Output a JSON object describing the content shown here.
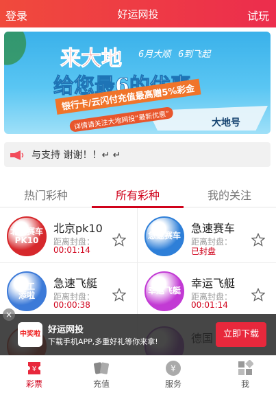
{
  "header": {
    "login": "登录",
    "title": "好运网投",
    "trial": "试玩"
  },
  "banner": {
    "line1": "来大地",
    "tag1": "6月大顺",
    "tag2": "6到飞起",
    "line2": "给您最6的优惠",
    "line3": "银行卡/云闪付充值最高赠5%彩金",
    "line4": "详情请关注大地网投“最新优惠”",
    "ship": "大地号"
  },
  "notice": {
    "text": "与支持 谢谢！！↵ ↵"
  },
  "tabs": [
    "热门彩种",
    "所有彩种",
    "我的关注"
  ],
  "games": [
    {
      "logo": "北京赛车\nPK10",
      "name": "北京pk10",
      "label": "距离封盘：",
      "time": "00:01:14",
      "color": "#d6282c"
    },
    {
      "logo": "急速赛车",
      "name": "急速赛车",
      "label": "距离封盘：",
      "time": "已封盘",
      "color": "#2e7fd8"
    },
    {
      "logo": "领工\n添啦",
      "name": "急速飞艇",
      "label": "距离封盘：",
      "time": "00:00:38",
      "color": "#3c7ad8"
    },
    {
      "logo": "幸运飞艇",
      "name": "幸运飞艇",
      "label": "距离封盘：",
      "time": "00:01:14",
      "color": "#c23ad4"
    },
    {
      "logo": "",
      "name": "",
      "label": "",
      "time": "",
      "color": "#c9432c"
    },
    {
      "logo": "",
      "name": "德国",
      "label": "",
      "time": "",
      "color": "#9a49c2"
    }
  ],
  "appbar": {
    "close": "×",
    "icon": "中奖啦",
    "title": "好运网投",
    "subtitle": "下载手机APP,多重好礼等你来拿!",
    "button": "立即下载"
  },
  "nav": [
    "彩票",
    "充值",
    "服务",
    "我"
  ],
  "colors": {
    "accent": "#d0021b",
    "header": "#ec2d4d"
  }
}
